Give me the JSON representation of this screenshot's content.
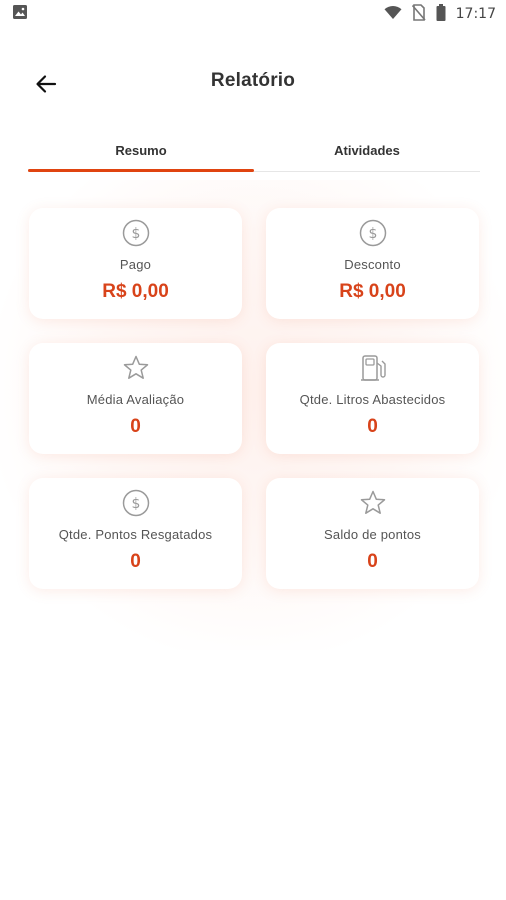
{
  "status_bar": {
    "time": "17:17",
    "icons": [
      "image-icon",
      "wifi-icon",
      "no-sim-icon",
      "battery-icon"
    ]
  },
  "header": {
    "title": "Relatório",
    "back_icon": "arrow-left-icon"
  },
  "tabs": [
    {
      "label": "Resumo",
      "active": true
    },
    {
      "label": "Atividades",
      "active": false
    }
  ],
  "cards": [
    {
      "label": "Pago",
      "value": "R$ 0,00",
      "icon": "dollar-circle-icon"
    },
    {
      "label": "Desconto",
      "value": "R$ 0,00",
      "icon": "dollar-circle-icon"
    },
    {
      "label": "Média Avaliação",
      "value": "0",
      "icon": "star-icon"
    },
    {
      "label": "Qtde. Litros Abastecidos",
      "value": "0",
      "icon": "fuel-pump-icon"
    },
    {
      "label": "Qtde. Pontos Resgatados",
      "value": "0",
      "icon": "dollar-circle-icon"
    },
    {
      "label": "Saldo de pontos",
      "value": "0",
      "icon": "star-icon"
    }
  ],
  "colors": {
    "accent": "#d8431a",
    "tab_indicator": "#e04410",
    "icon_gray": "#9a9a9a"
  }
}
